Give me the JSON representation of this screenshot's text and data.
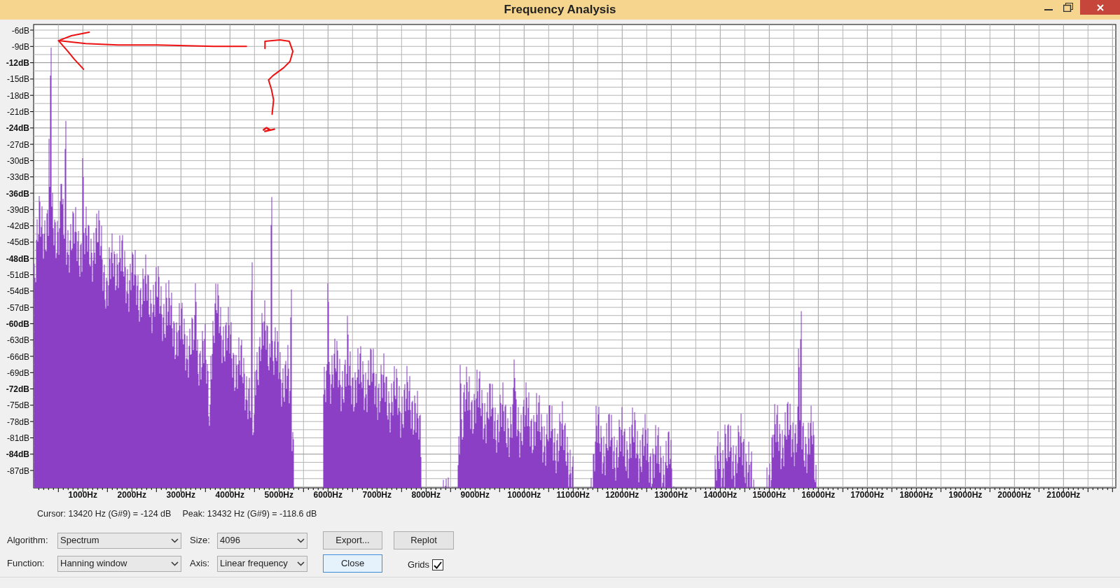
{
  "window": {
    "title": "Frequency Analysis"
  },
  "plot": {
    "y_labels": [
      {
        "label": "-6dB",
        "major": false
      },
      {
        "label": "-9dB",
        "major": false
      },
      {
        "label": "-12dB",
        "major": true
      },
      {
        "label": "-15dB",
        "major": false
      },
      {
        "label": "-18dB",
        "major": false
      },
      {
        "label": "-21dB",
        "major": false
      },
      {
        "label": "-24dB",
        "major": true
      },
      {
        "label": "-27dB",
        "major": false
      },
      {
        "label": "-30dB",
        "major": false
      },
      {
        "label": "-33dB",
        "major": false
      },
      {
        "label": "-36dB",
        "major": true
      },
      {
        "label": "-39dB",
        "major": false
      },
      {
        "label": "-42dB",
        "major": false
      },
      {
        "label": "-45dB",
        "major": false
      },
      {
        "label": "-48dB",
        "major": true
      },
      {
        "label": "-51dB",
        "major": false
      },
      {
        "label": "-54dB",
        "major": false
      },
      {
        "label": "-57dB",
        "major": false
      },
      {
        "label": "-60dB",
        "major": true
      },
      {
        "label": "-63dB",
        "major": false
      },
      {
        "label": "-66dB",
        "major": false
      },
      {
        "label": "-69dB",
        "major": false
      },
      {
        "label": "-72dB",
        "major": true
      },
      {
        "label": "-75dB",
        "major": false
      },
      {
        "label": "-78dB",
        "major": false
      },
      {
        "label": "-81dB",
        "major": false
      },
      {
        "label": "-84dB",
        "major": true
      },
      {
        "label": "-87dB",
        "major": false
      }
    ],
    "x_labels": [
      "1000Hz",
      "2000Hz",
      "3000Hz",
      "4000Hz",
      "5000Hz",
      "6000Hz",
      "7000Hz",
      "8000Hz",
      "9000Hz",
      "10000Hz",
      "11000Hz",
      "12000Hz",
      "13000Hz",
      "14000Hz",
      "15000Hz",
      "16000Hz",
      "17000Hz",
      "18000Hz",
      "19000Hz",
      "20000Hz",
      "21000Hz"
    ]
  },
  "cursor_readout": "Cursor: 13420 Hz (G#9) = -124 dB",
  "peak_readout": "Peak: 13432 Hz (G#9) = -118.6 dB",
  "algorithm": {
    "label": "Algorithm:",
    "value": "Spectrum"
  },
  "size": {
    "label": "Size:",
    "value": "4096"
  },
  "function": {
    "label": "Function:",
    "value": "Hanning window"
  },
  "axis": {
    "label": "Axis:",
    "value": "Linear frequency"
  },
  "buttons": {
    "export": "Export...",
    "replot": "Replot",
    "close": "Close"
  },
  "grids": {
    "label": "Grids",
    "checked": true
  }
}
